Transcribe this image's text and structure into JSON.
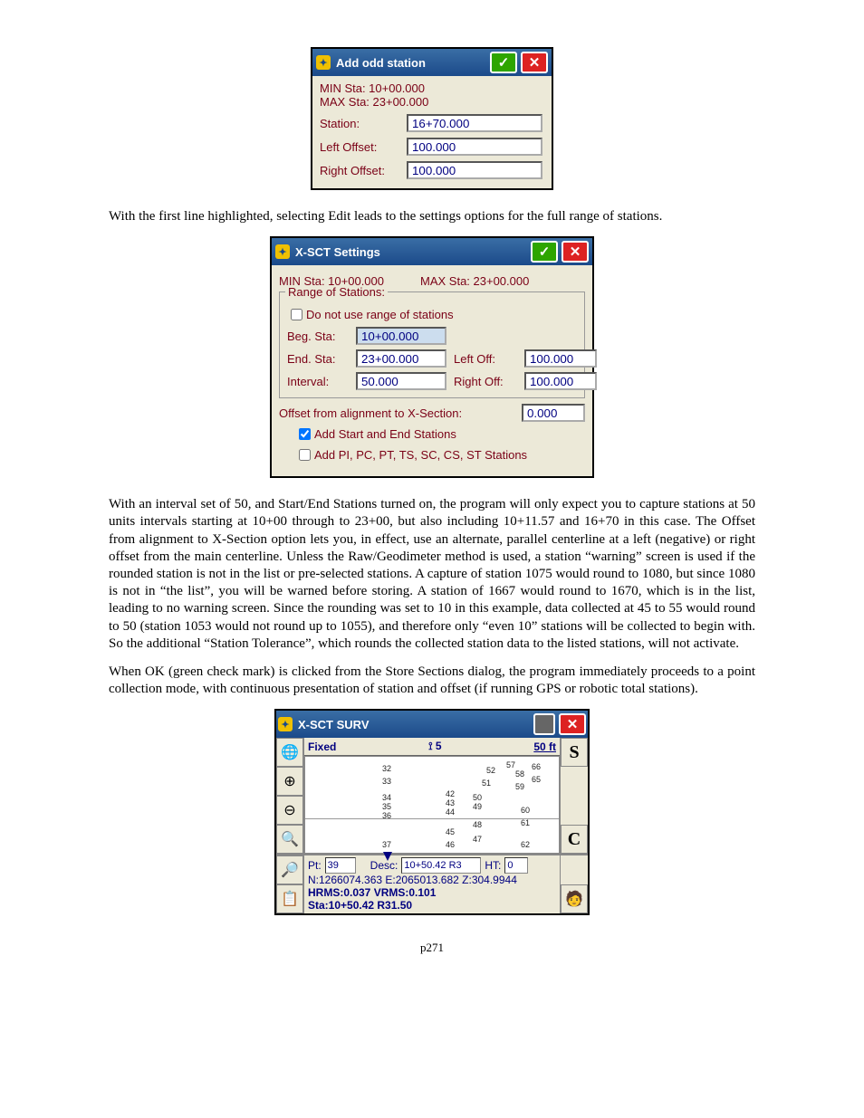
{
  "add_odd": {
    "title": "Add odd station",
    "min_sta_label": "MIN Sta: 10+00.000",
    "max_sta_label": "MAX Sta: 23+00.000",
    "fields": {
      "station_label": "Station:",
      "station_value": "16+70.000",
      "left_label": "Left Offset:",
      "left_value": "100.000",
      "right_label": "Right Offset:",
      "right_value": "100.000"
    }
  },
  "para1": "With the first line highlighted, selecting Edit leads to the settings options for the full range of stations.",
  "xsct_settings": {
    "title": "X-SCT Settings",
    "min_sta": "MIN Sta: 10+00.000",
    "max_sta": "MAX Sta: 23+00.000",
    "range_title": "Range of Stations:",
    "do_not_use_label": "Do not use range of stations",
    "do_not_use_checked": false,
    "beg_label": "Beg. Sta:",
    "beg_value": "10+00.000",
    "end_label": "End. Sta:",
    "end_value": "23+00.000",
    "interval_label": "Interval:",
    "interval_value": "50.000",
    "left_label": "Left Off:",
    "left_value": "100.000",
    "right_label": "Right Off:",
    "right_value": "100.000",
    "offset_label": "Offset from alignment to X-Section:",
    "offset_value": "0.000",
    "add_start_end_label": "Add Start and End Stations",
    "add_start_end_checked": true,
    "add_pi_label": "Add PI, PC, PT, TS, SC, CS, ST Stations",
    "add_pi_checked": false
  },
  "para2": "With an interval set of 50, and Start/End Stations turned on, the program will only expect you to capture stations at 50 units intervals starting at 10+00 through to 23+00, but also including 10+11.57 and 16+70 in this case.  The Offset from alignment to X-Section option lets you, in effect, use an alternate, parallel centerline at a left (negative) or right offset from the main centerline.  Unless the Raw/Geodimeter method is used, a station “warning” screen is used if the rounded station is not in the list or pre-selected stations.  A capture of station 1075 would round to 1080, but since 1080 is not in “the list”, you will be warned before storing.  A station of 1667 would round to 1670, which is in the list, leading to no warning screen.  Since the rounding was set to 10 in this example, data collected at 45 to 55 would round to 50 (station 1053 would not round up to 1055), and therefore only “even 10” stations will be collected to begin with.  So the additional “Station Tolerance”, which rounds the collected station data to the listed stations, will not activate.",
  "para3": "When OK (green check mark) is clicked from the Store Sections dialog, the program immediately proceeds to a point collection mode, with continuous presentation of station and offset (if running GPS or robotic total stations).",
  "surv": {
    "title": "X-SCT SURV",
    "status_fixed": "Fixed",
    "status_sat": "5",
    "status_dist": "50 ft",
    "pt_label": "Pt:",
    "pt_value": "39",
    "desc_label": "Desc:",
    "desc_value": "10+50.42 R3",
    "ht_label": "HT:",
    "ht_value": "0",
    "coords": "N:1266074.363 E:2065013.682 Z:304.9944",
    "hrms": "HRMS:0.037 VRMS:0.101",
    "sta": "Sta:10+50.42 R31.50",
    "s_letter": "S",
    "c_letter": "C",
    "map_points": [
      "32",
      "33",
      "34",
      "35",
      "36",
      "37",
      "42",
      "43",
      "44",
      "45",
      "46",
      "47",
      "48",
      "49",
      "50",
      "51",
      "52",
      "57",
      "58",
      "59",
      "60",
      "61",
      "62",
      "65",
      "66"
    ]
  },
  "page_number": "p271"
}
